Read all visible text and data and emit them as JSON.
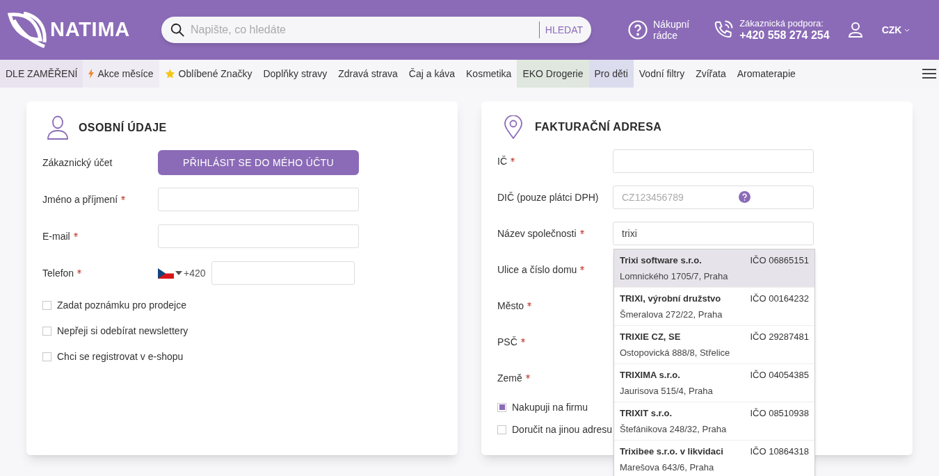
{
  "header": {
    "logo": "NATIMA",
    "search": {
      "placeholder": "Napište, co hledáte",
      "button": "HLEDAT"
    },
    "guide": [
      "Nákupní",
      "rádce"
    ],
    "support": {
      "label": "Zákaznická podpora:",
      "phone": "+420 558 274 254"
    },
    "currency": "CZK"
  },
  "nav": [
    {
      "label": "DLE ZAMĚŘENÍ",
      "kind": "plain",
      "color": "#e9e3ef"
    },
    {
      "label": "Akce měsíce",
      "kind": "promo",
      "color": "#efedf3"
    },
    {
      "label": "Oblíbené Značky",
      "kind": "favorite"
    },
    {
      "label": "Doplňky stravy",
      "kind": "plain"
    },
    {
      "label": "Zdravá strava",
      "kind": "plain"
    },
    {
      "label": "Čaj a káva",
      "kind": "plain"
    },
    {
      "label": "Kosmetika",
      "kind": "plain"
    },
    {
      "label": "EKO Drogerie",
      "kind": "plain",
      "color": "#dfe7df"
    },
    {
      "label": "Pro děti",
      "kind": "plain",
      "color": "#dcdcef"
    },
    {
      "label": "Vodní filtry",
      "kind": "plain"
    },
    {
      "label": "Zvířata",
      "kind": "plain"
    },
    {
      "label": "Aromaterapie",
      "kind": "plain"
    }
  ],
  "personal": {
    "title": "OSOBNÍ ÚDAJE",
    "fields": [
      {
        "label": "Zákaznický účet",
        "required": false,
        "kind": "button",
        "button": "PŘIHLÁSIT SE DO MÉHO ÚČTU"
      },
      {
        "label": "Jméno a příjmení",
        "required": true,
        "kind": "input"
      },
      {
        "label": "E-mail",
        "required": true,
        "kind": "input"
      },
      {
        "label": "Telefon",
        "required": true,
        "kind": "phone",
        "prefix": "+420"
      }
    ],
    "checkboxes": [
      {
        "label": "Zadat poznámku pro prodejce",
        "checked": false
      },
      {
        "label": "Nepřeji si odebírat newslettery",
        "checked": false
      },
      {
        "label": "Chci se registrovat v e-shopu",
        "checked": false
      }
    ]
  },
  "billing": {
    "title": "FAKTURAČNÍ ADRESA",
    "fields": [
      {
        "label": "IČ",
        "required": true,
        "kind": "input"
      },
      {
        "label": "DIČ (pouze plátci DPH)",
        "required": false,
        "kind": "help",
        "placeholder": "CZ123456789"
      },
      {
        "label": "Název společnosti",
        "required": true,
        "kind": "input",
        "value": "trixi"
      },
      {
        "label": "Ulice a číslo domu",
        "required": true,
        "kind": "hidden"
      },
      {
        "label": "Město",
        "required": true,
        "kind": "hidden"
      },
      {
        "label": "PSČ",
        "required": true,
        "kind": "hidden"
      },
      {
        "label": "Země",
        "required": true,
        "kind": "hidden"
      }
    ],
    "checkboxes": [
      {
        "label": "Nakupuji na firmu",
        "checked": true
      },
      {
        "label": "Doručit na jinou adresu",
        "checked": false
      }
    ],
    "suggestions": [
      {
        "name": "Trixi software s.r.o.",
        "ico": "IČO 06865151",
        "address": "Lomnického 1705/7, Praha",
        "selected": true
      },
      {
        "name": "TRIXI, výrobní družstvo",
        "ico": "IČO 00164232",
        "address": "Šmeralova 272/22, Praha",
        "selected": false
      },
      {
        "name": "TRIXIE CZ, SE",
        "ico": "IČO 29287481",
        "address": "Ostopovická 888/8, Střelice",
        "selected": false
      },
      {
        "name": "TRIXIMA s.r.o.",
        "ico": "IČO 04054385",
        "address": "Jaurisova 515/4, Praha",
        "selected": false
      },
      {
        "name": "TRIXIT s.r.o.",
        "ico": "IČO 08510938",
        "address": "Štefánikova 248/32, Praha",
        "selected": false
      },
      {
        "name": "Trixibee s.r.o. v likvidaci",
        "ico": "IČO 10864318",
        "address": "Marešova 643/6, Praha",
        "selected": false
      }
    ]
  }
}
